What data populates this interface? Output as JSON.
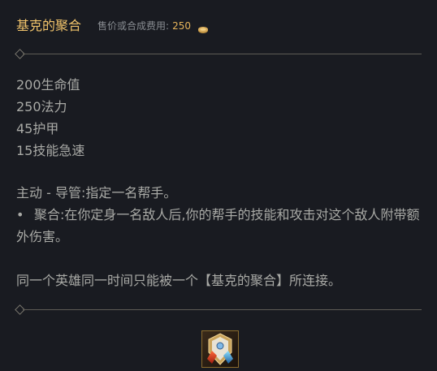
{
  "item": {
    "name": "基克的聚合",
    "cost_label": "售价或合成费用:",
    "cost_value": "250",
    "coin_icon": "gold-coin-icon"
  },
  "stats": [
    "200生命值",
    "250法力",
    "45护甲",
    "15技能急速"
  ],
  "description": {
    "active": "主动 - 导管:指定一名帮手。",
    "bullet_symbol": "•",
    "passive": "聚合:在你定身一名敌人后,你的帮手的技能和攻击对这个敌人附带额外伤害。",
    "note": "同一个英雄同一时间只能被一个【基克的聚合】所连接。"
  },
  "colors": {
    "background": "#191b21",
    "title": "#f0c36b",
    "cost_value": "#e6b45a",
    "body_text": "#a9aaa6",
    "divider": "#5e5c55"
  },
  "icon": "zekes-convergence-item-icon"
}
